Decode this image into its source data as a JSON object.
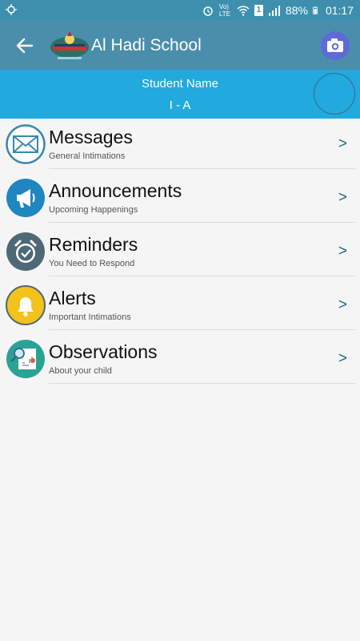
{
  "status_bar": {
    "battery": "88%",
    "time": "01:17",
    "sim_slot": "1",
    "network": "Vo) LTE",
    "icons": [
      "sync-icon",
      "alarm-icon",
      "volte-icon",
      "wifi-icon",
      "sim-icon",
      "signal-icon",
      "battery-icon"
    ]
  },
  "app_bar": {
    "title": "Al Hadi School",
    "icons": [
      "back-arrow-icon",
      "school-logo",
      "camera-icon"
    ],
    "colors": {
      "background": "#4a8eab",
      "camera_button": "#5c6bd6"
    }
  },
  "student": {
    "name": "Student Name",
    "class": "I - A",
    "colors": {
      "background": "#22a9de"
    }
  },
  "menu": {
    "items": [
      {
        "title": "Messages",
        "subtitle": "General Intimations",
        "chevron": ">",
        "icon": "envelope-icon"
      },
      {
        "title": "Announcements",
        "subtitle": "Upcoming Happenings",
        "chevron": ">",
        "icon": "megaphone-icon"
      },
      {
        "title": "Reminders",
        "subtitle": "You Need to Respond",
        "chevron": ">",
        "icon": "alarm-clock-icon"
      },
      {
        "title": "Alerts",
        "subtitle": "Important Intimations",
        "chevron": ">",
        "icon": "bell-icon"
      },
      {
        "title": "Observations",
        "subtitle": "About your child",
        "chevron": ">",
        "icon": "report-icon"
      }
    ]
  }
}
